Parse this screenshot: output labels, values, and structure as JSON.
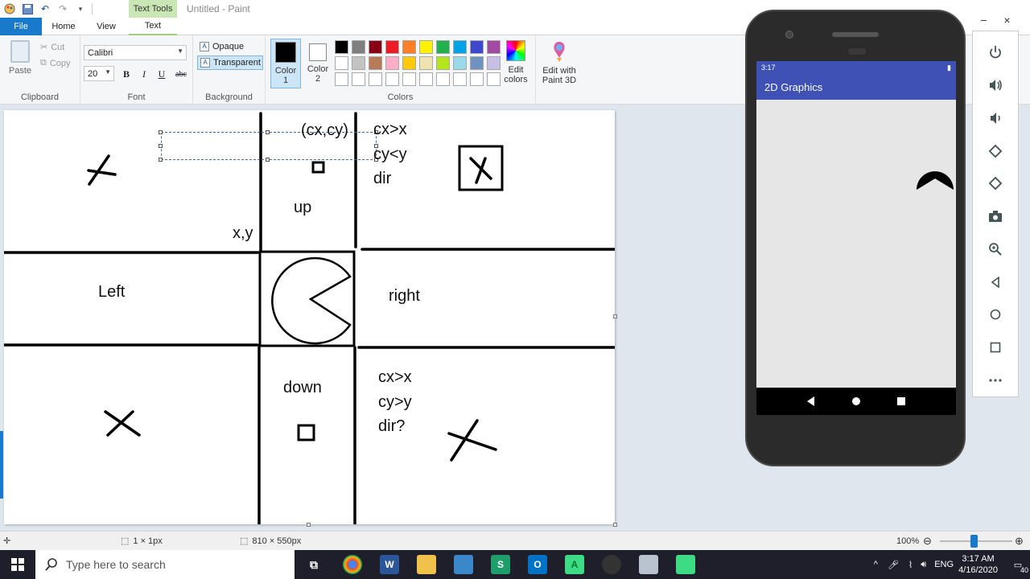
{
  "title": {
    "context_tab": "Text Tools",
    "document": "Untitled - Paint"
  },
  "tabs": [
    "File",
    "Home",
    "View",
    "Text"
  ],
  "ribbon": {
    "clipboard": {
      "label": "Clipboard",
      "paste": "Paste",
      "cut": "Cut",
      "copy": "Copy"
    },
    "font": {
      "label": "Font",
      "family": "Calibri",
      "size": "20",
      "bold": "B",
      "italic": "I",
      "underline": "U",
      "strike": "abc"
    },
    "background": {
      "label": "Background",
      "opaque": "Opaque",
      "transparent": "Transparent"
    },
    "colors": {
      "label": "Colors",
      "color1_label": "Color 1",
      "color2_label": "Color 2",
      "color1": "#000000",
      "color2": "#ffffff",
      "palette": [
        "#000000",
        "#7f7f7f",
        "#880015",
        "#ed1c24",
        "#ff7f27",
        "#fff200",
        "#22b14c",
        "#00a2e8",
        "#3f48cc",
        "#a349a4",
        "#ffffff",
        "#c3c3c3",
        "#b97a57",
        "#ffaec9",
        "#ffc90e",
        "#efe4b0",
        "#b5e61d",
        "#99d9ea",
        "#7092be",
        "#c8bfe7",
        "#ffffff",
        "#ffffff",
        "#ffffff",
        "#ffffff",
        "#ffffff",
        "#ffffff",
        "#ffffff",
        "#ffffff",
        "#ffffff",
        "#ffffff"
      ],
      "edit_colors": "Edit colors",
      "edit_paint3d": "Edit with Paint 3D"
    }
  },
  "canvas": {
    "labels": {
      "cxcy": "(cx,cy)",
      "cx_gt_x_top": "cx>x",
      "cy_lt_y": "cy<y",
      "dir_top": "dir",
      "up": "up",
      "xy": "x,y",
      "left": "Left",
      "right": "right",
      "down": "down",
      "cx_gt_x_bottom": "cx>x",
      "cy_gt_y": "cy>y",
      "dir_bottom": "dir?"
    }
  },
  "statusbar": {
    "selection_size": "1 × 1px",
    "canvas_size": "810 × 550px",
    "zoom": "100%"
  },
  "taskbar": {
    "search_placeholder": "Type here to search",
    "lang": "ENG",
    "time": "3:17 AM",
    "date": "4/16/2020",
    "notifications": "40"
  },
  "emulator": {
    "status_time": "3:17",
    "app_title": "2D Graphics",
    "tools": [
      "power-icon",
      "volume-up-icon",
      "volume-down-icon",
      "rotate-left-icon",
      "rotate-right-icon",
      "camera-icon",
      "zoom-icon",
      "back-icon",
      "home-icon",
      "overview-icon",
      "more-icon"
    ]
  },
  "accent": {
    "file_tab": "#1979ca",
    "text_tools": "#c9e6b4",
    "app_bar": "#3f51b5"
  }
}
